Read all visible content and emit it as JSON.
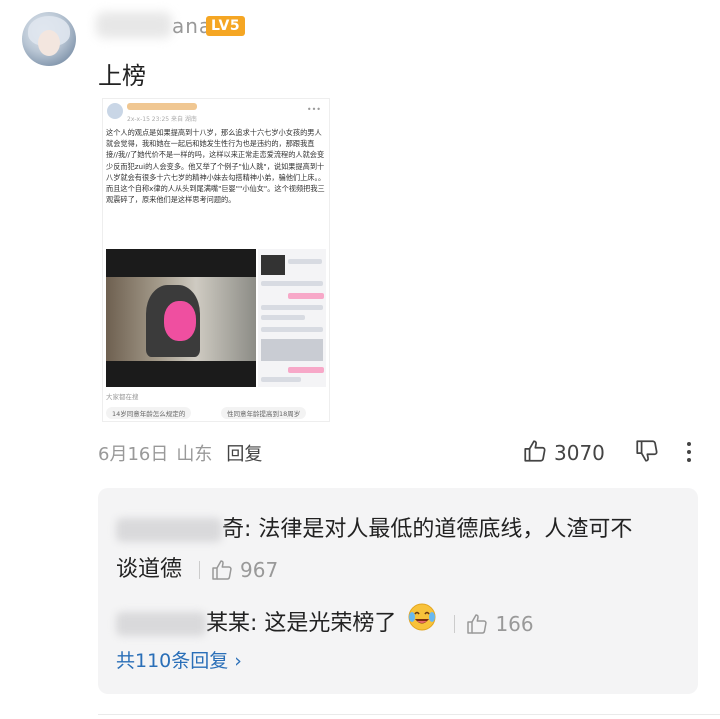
{
  "comment": {
    "username_visible": "ana",
    "level_badge": "LV5",
    "text": "上榜",
    "date": "6月16日",
    "region": "山东",
    "reply_label": "回复",
    "like_count": "3070"
  },
  "embedded_post": {
    "date_line": "2x-x-15 23:25  来自 湖南",
    "body": "这个人的观点是如果提高到十八岁，那么追求十六七岁小女孩的男人就会觉得，我和她在一起后和她发生性行为也是违约的，那跟我直接//我//了她代价不是一样的吗，这样以来正常走恋爱流程的人就会变少反而犯zui的人会变多。他又举了个例子\"仙人跳\"，说如果提高到十八岁就会有很多十六七岁的精神小妹去勾搭精神小弟，骗他们上床。。而且这个自称x律的人从头到尾满嘴\"巨婴\"\"小仙女\"。这个视频把我三观震碎了，原来他们是这样思考问题的。",
    "footer": "大家都在搜",
    "suggestion1": "14岁同意年龄怎么规定的",
    "suggestion2": "性同意年龄提高到18周岁"
  },
  "replies": [
    {
      "name_tail": "奇",
      "text": "法律是对人最低的道德底线，人渣可不",
      "text_cont": "谈道德",
      "like_count": "967"
    },
    {
      "name_tail": "某某",
      "text": "这是光荣榜了",
      "like_count": "166"
    }
  ],
  "all_replies_label": "共110条回复 ›",
  "colors": {
    "badge": "#f5a623",
    "link": "#2a6fb8",
    "reply_bg": "#f4f4f5",
    "muted": "#999999"
  },
  "icons": [
    "avatar",
    "thumbs-up-icon",
    "thumbs-down-icon",
    "more-vertical-icon",
    "laughing-crying-emoji"
  ]
}
